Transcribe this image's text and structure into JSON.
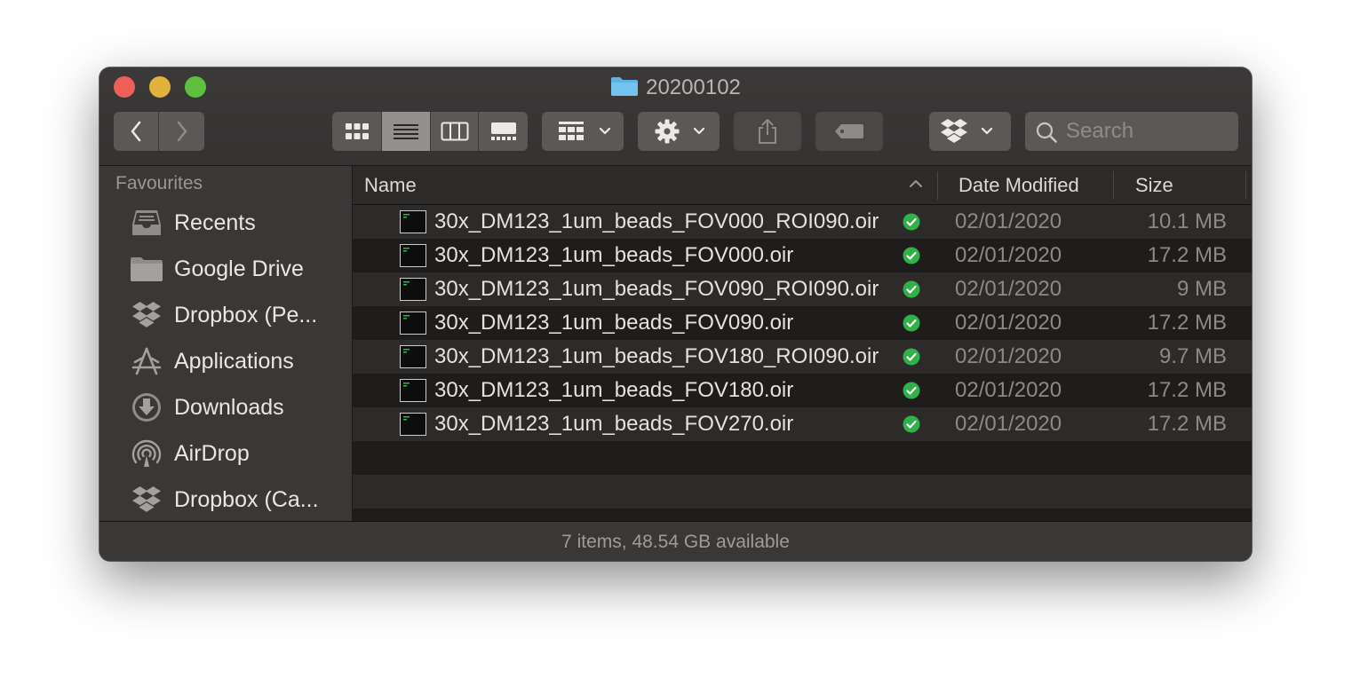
{
  "window": {
    "title": "20200102"
  },
  "toolbar": {
    "search_placeholder": "Search"
  },
  "sidebar": {
    "heading": "Favourites",
    "items": [
      {
        "label": "Recents",
        "icon": "recents-icon"
      },
      {
        "label": "Google Drive",
        "icon": "folder-icon"
      },
      {
        "label": "Dropbox (Pe...",
        "icon": "dropbox-icon"
      },
      {
        "label": "Applications",
        "icon": "applications-icon"
      },
      {
        "label": "Downloads",
        "icon": "downloads-icon"
      },
      {
        "label": "AirDrop",
        "icon": "airdrop-icon"
      },
      {
        "label": "Dropbox (Ca...",
        "icon": "dropbox-icon"
      }
    ]
  },
  "columns": {
    "name": "Name",
    "date": "Date Modified",
    "size": "Size"
  },
  "files": [
    {
      "name": "30x_DM123_1um_beads_FOV000_ROI090.oir",
      "date": "02/01/2020",
      "size": "10.1 MB"
    },
    {
      "name": "30x_DM123_1um_beads_FOV000.oir",
      "date": "02/01/2020",
      "size": "17.2 MB"
    },
    {
      "name": "30x_DM123_1um_beads_FOV090_ROI090.oir",
      "date": "02/01/2020",
      "size": "9 MB"
    },
    {
      "name": "30x_DM123_1um_beads_FOV090.oir",
      "date": "02/01/2020",
      "size": "17.2 MB"
    },
    {
      "name": "30x_DM123_1um_beads_FOV180_ROI090.oir",
      "date": "02/01/2020",
      "size": "9.7 MB"
    },
    {
      "name": "30x_DM123_1um_beads_FOV180.oir",
      "date": "02/01/2020",
      "size": "17.2 MB"
    },
    {
      "name": "30x_DM123_1um_beads_FOV270.oir",
      "date": "02/01/2020",
      "size": "17.2 MB"
    }
  ],
  "status": {
    "text": "7 items, 48.54 GB available"
  },
  "colors": {
    "close": "#ed5f58",
    "minimize": "#e1b33c",
    "maximize": "#5dc03f",
    "folder": "#5bb3e6",
    "sync_ok": "#2fb24a"
  }
}
